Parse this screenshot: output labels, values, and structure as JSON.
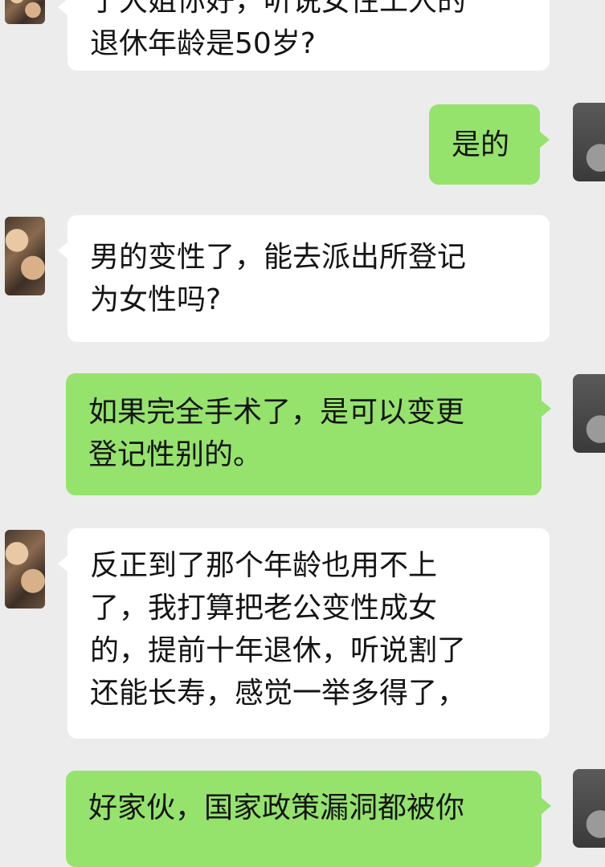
{
  "messages": [
    {
      "side": "in",
      "lines": [
        "于大姐你好，听说女性工人的",
        "退休年龄是50岁?"
      ]
    },
    {
      "side": "out",
      "lines": [
        "是的"
      ]
    },
    {
      "side": "in",
      "lines": [
        "男的变性了，能去派出所登记",
        "为女性吗?"
      ]
    },
    {
      "side": "out",
      "lines": [
        "如果完全手术了，是可以变更",
        "登记性别的。"
      ]
    },
    {
      "side": "in",
      "lines": [
        "反正到了那个年龄也用不上",
        "了，我打算把老公变性成女",
        "的，提前十年退休，听说割了",
        "还能长寿，感觉一举多得了，"
      ]
    },
    {
      "side": "out",
      "lines": [
        "好家伙，国家政策漏洞都被你"
      ]
    }
  ]
}
